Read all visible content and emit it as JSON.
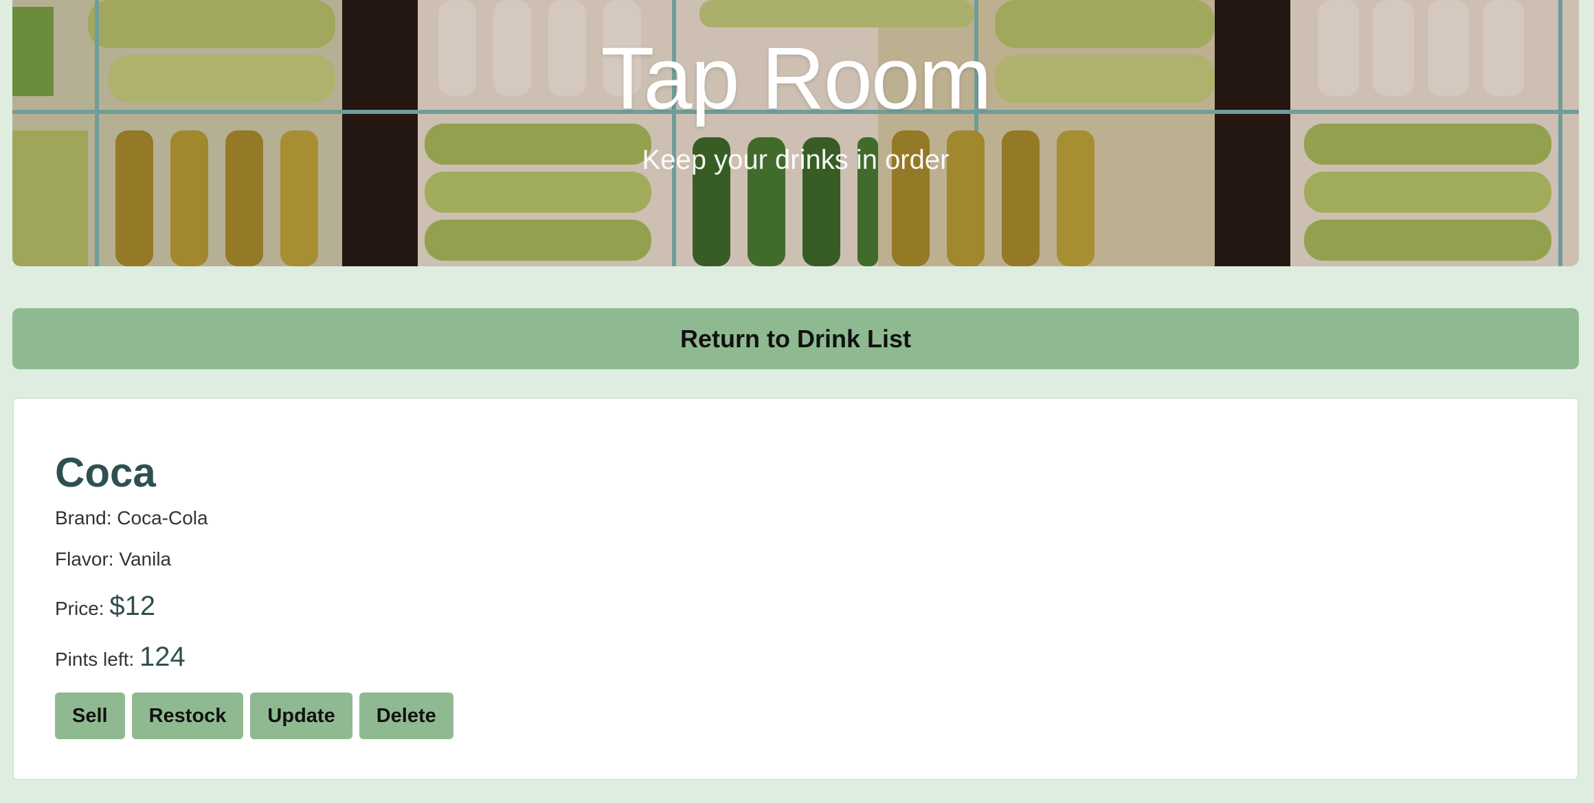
{
  "hero": {
    "title": "Tap Room",
    "subtitle": "Keep your drinks in order"
  },
  "nav": {
    "return_label": "Return to Drink List"
  },
  "drink": {
    "name": "Coca",
    "brand_label": "Brand:",
    "brand": "Coca-Cola",
    "flavor_label": "Flavor:",
    "flavor": "Vanila",
    "price_label": "Price:",
    "price": "$12",
    "pints_label": "Pints left:",
    "pints": "124"
  },
  "actions": {
    "sell": "Sell",
    "restock": "Restock",
    "update": "Update",
    "delete": "Delete"
  },
  "colors": {
    "page_bg": "#dfede1",
    "accent_green": "#8fba91",
    "heading_teal": "#2f5050"
  }
}
